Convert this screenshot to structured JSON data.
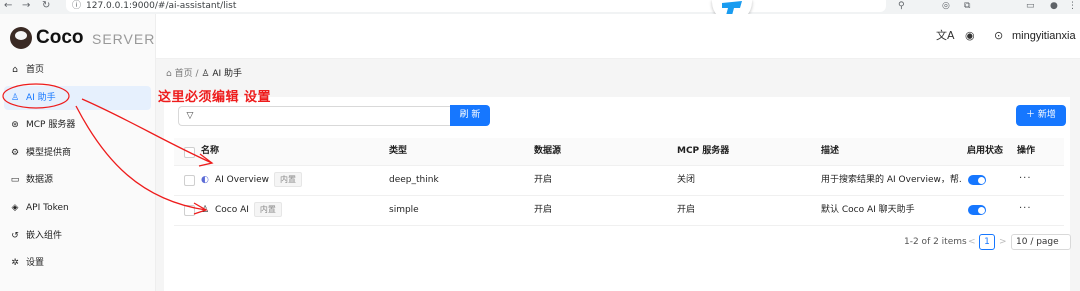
{
  "browser": {
    "url": "127.0.0.1:9000/#/ai-assistant/list"
  },
  "sidebar": {
    "logo": {
      "name": "Coco",
      "suffix": "SERVER"
    },
    "items": [
      {
        "label": "首页",
        "icon": "home-icon",
        "active": false
      },
      {
        "label": "AI 助手",
        "icon": "robot-icon",
        "active": true
      },
      {
        "label": "MCP 服务器",
        "icon": "mcp-server-icon",
        "active": false
      },
      {
        "label": "模型提供商",
        "icon": "model-provider-icon",
        "active": false
      },
      {
        "label": "数据源",
        "icon": "folder-icon",
        "active": false
      },
      {
        "label": "API Token",
        "icon": "shield-icon",
        "active": false
      },
      {
        "label": "嵌入组件",
        "icon": "embed-icon",
        "active": false
      },
      {
        "label": "设置",
        "icon": "gear-icon",
        "active": false
      }
    ]
  },
  "header": {
    "user_name": "mingyitianxia"
  },
  "breadcrumb": {
    "home": "首页",
    "separator": "/",
    "current": "AI 助手"
  },
  "toolbar": {
    "refresh_label": "刷 新",
    "new_label": "新增",
    "search_value": ""
  },
  "table": {
    "columns": [
      "名称",
      "类型",
      "数据源",
      "MCP 服务器",
      "描述",
      "启用状态",
      "操作"
    ],
    "rows": [
      {
        "name": "AI Overview",
        "tag": "内置",
        "type": "deep_think",
        "datasource": "开启",
        "mcp": "关闭",
        "desc": "用于搜索结果的 AI Overview，帮...",
        "enabled": true,
        "actions": "···"
      },
      {
        "name": "Coco AI",
        "tag": "内置",
        "type": "simple",
        "datasource": "开启",
        "mcp": "开启",
        "desc": "默认 Coco AI 聊天助手",
        "enabled": true,
        "actions": "···"
      }
    ]
  },
  "pagination": {
    "summary": "1-2 of 2 items",
    "prev": "<",
    "page": "1",
    "next": ">",
    "page_size": "10 / page"
  },
  "annotation": {
    "text": "这里必须编辑 设置",
    "color": "#ee1c1c"
  },
  "colors": {
    "primary": "#1677ff",
    "active_bg": "#e6f0fd"
  }
}
